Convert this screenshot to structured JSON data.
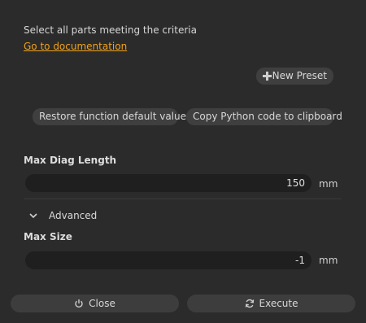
{
  "description": "Select all parts meeting the criteria",
  "doc_link": "Go to documentation",
  "preset_button": {
    "label": "New Preset",
    "icon": "plus-icon"
  },
  "restore_button": "Restore function default values",
  "copy_button": "Copy Python code to clipboard",
  "max_diag_length": {
    "label": "Max Diag Length",
    "value": "150",
    "unit": "mm"
  },
  "advanced": {
    "label": "Advanced",
    "icon": "chevron-down-icon"
  },
  "max_size": {
    "label": "Max Size",
    "value": "-1",
    "unit": "mm"
  },
  "footer": {
    "close_label": "Close",
    "close_icon": "power-icon",
    "execute_label": "Execute",
    "execute_icon": "refresh-icon"
  },
  "colors": {
    "background": "#2b2b2b",
    "link": "#f0a21a",
    "button": "#3f3f3f",
    "field": "#1f1f1f"
  }
}
